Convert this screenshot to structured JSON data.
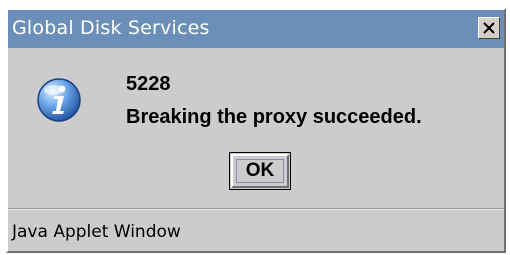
{
  "window": {
    "title": "Global Disk Services",
    "titlebar_color": "#6b8fb8",
    "background_color": "#cccccc"
  },
  "message": {
    "icon": "information-icon",
    "code": "5228",
    "text": "Breaking the proxy succeeded."
  },
  "buttons": {
    "ok_label": "OK"
  },
  "status_bar": {
    "text": "Java Applet Window"
  }
}
